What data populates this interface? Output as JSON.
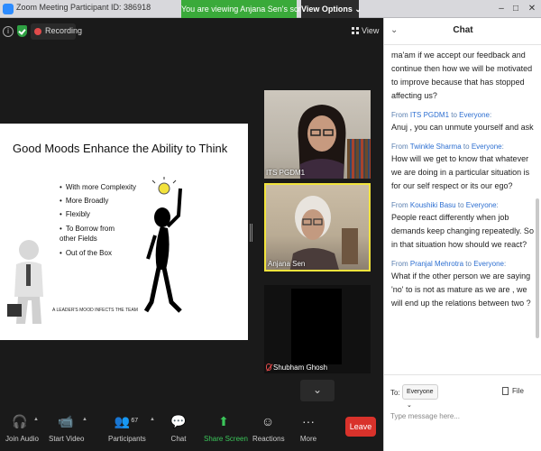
{
  "titlebar": {
    "title": "Zoom Meeting Participant ID: 386918",
    "viewing_banner": "You are viewing Anjana Sen's screen",
    "view_options": "View Options ⌄",
    "min": "–",
    "max": "□",
    "close": "✕"
  },
  "meeting_bar": {
    "recording_label": "Recording",
    "view_label": "View"
  },
  "slide": {
    "title": "Good Moods Enhance the Ability to Think",
    "bullets": [
      "With more Complexity",
      "More Broadly",
      "Flexibly",
      "To Borrow from other Fields",
      "Out of the Box"
    ],
    "footer": "A LEADER'S MOOD INFECTS THE TEAM"
  },
  "participants": [
    {
      "name": "ITS PGDM1"
    },
    {
      "name": "Anjana Sen"
    },
    {
      "name": "Shubham Ghosh",
      "muted": true
    }
  ],
  "toolbar": {
    "join_audio": "Join Audio",
    "start_video": "Start Video",
    "participants": "Participants",
    "participant_count": "67",
    "chat": "Chat",
    "share_screen": "Share Screen",
    "reactions": "Reactions",
    "more": "More",
    "leave": "Leave"
  },
  "chat": {
    "title": "Chat",
    "first_text": "ma'am if we accept our feedback and continue then how we will be motivated to improve because that has stopped affecting us?",
    "messages": [
      {
        "from": "ITS PGDM1",
        "to": "Everyone",
        "text": "Anuj , you can unmute yourself and ask"
      },
      {
        "from": "Twinkle Sharma",
        "to": "Everyone",
        "text": "How will we get to know that whatever we are doing in a particular situation is for our self respect or its our ego?"
      },
      {
        "from": "Koushiki Basu",
        "to": "Everyone",
        "text": "People react differently when job demands keep changing repeatedly. So in that situation how should we react?"
      },
      {
        "from": "Pranjal Mehrotra",
        "to": "Everyone",
        "text": "What if the other person we are saying 'no' to is not as mature as we are , we will end up the relations between two ?"
      }
    ],
    "from_word": "From",
    "to_word": "to",
    "to_label": "To:",
    "to_value": "Everyone ⌄",
    "file_label": "File",
    "input_placeholder": "Type message here..."
  }
}
